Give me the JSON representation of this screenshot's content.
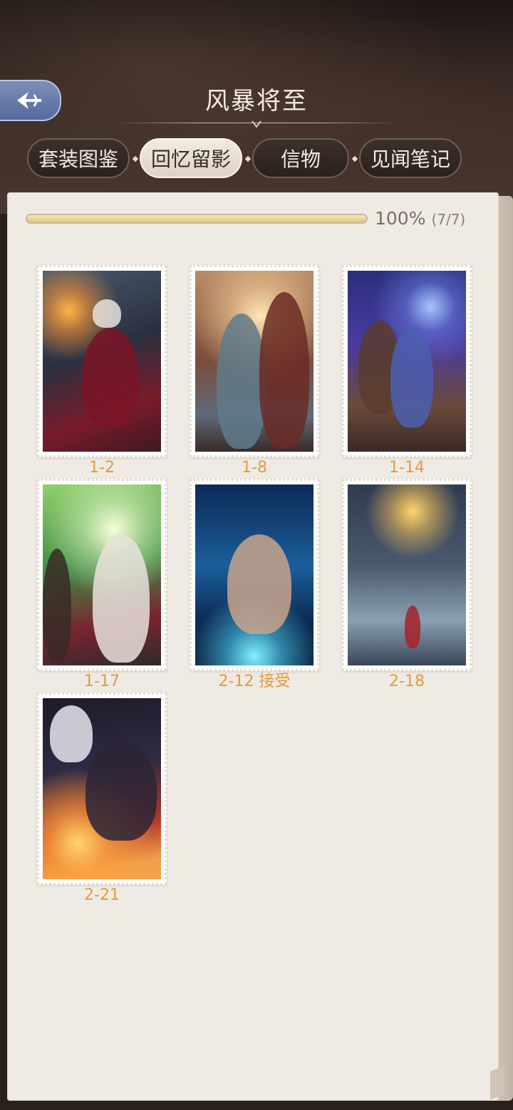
{
  "header": {
    "title": "风暴将至"
  },
  "tabs": [
    {
      "label": "套装图鉴",
      "active": false
    },
    {
      "label": "回忆留影",
      "active": true
    },
    {
      "label": "信物",
      "active": false
    },
    {
      "label": "见闻笔记",
      "active": false
    }
  ],
  "progress": {
    "percent_text": "100%",
    "count_text": "(7/7)",
    "value": 1.0
  },
  "cards": [
    {
      "label": "1-2",
      "art": "art-1"
    },
    {
      "label": "1-8",
      "art": "art-2"
    },
    {
      "label": "1-14",
      "art": "art-3"
    },
    {
      "label": "1-17",
      "art": "art-4"
    },
    {
      "label": "2-12 接受",
      "art": "art-5"
    },
    {
      "label": "2-18",
      "art": "art-6"
    },
    {
      "label": "2-21",
      "art": "art-7"
    }
  ],
  "icons": {
    "back": "back-arrow-icon"
  },
  "colors": {
    "accent_label": "#e39a3d",
    "progress_fill": "#e0c77c",
    "page_bg": "#efebe4",
    "header_bg": "#2b211c"
  }
}
